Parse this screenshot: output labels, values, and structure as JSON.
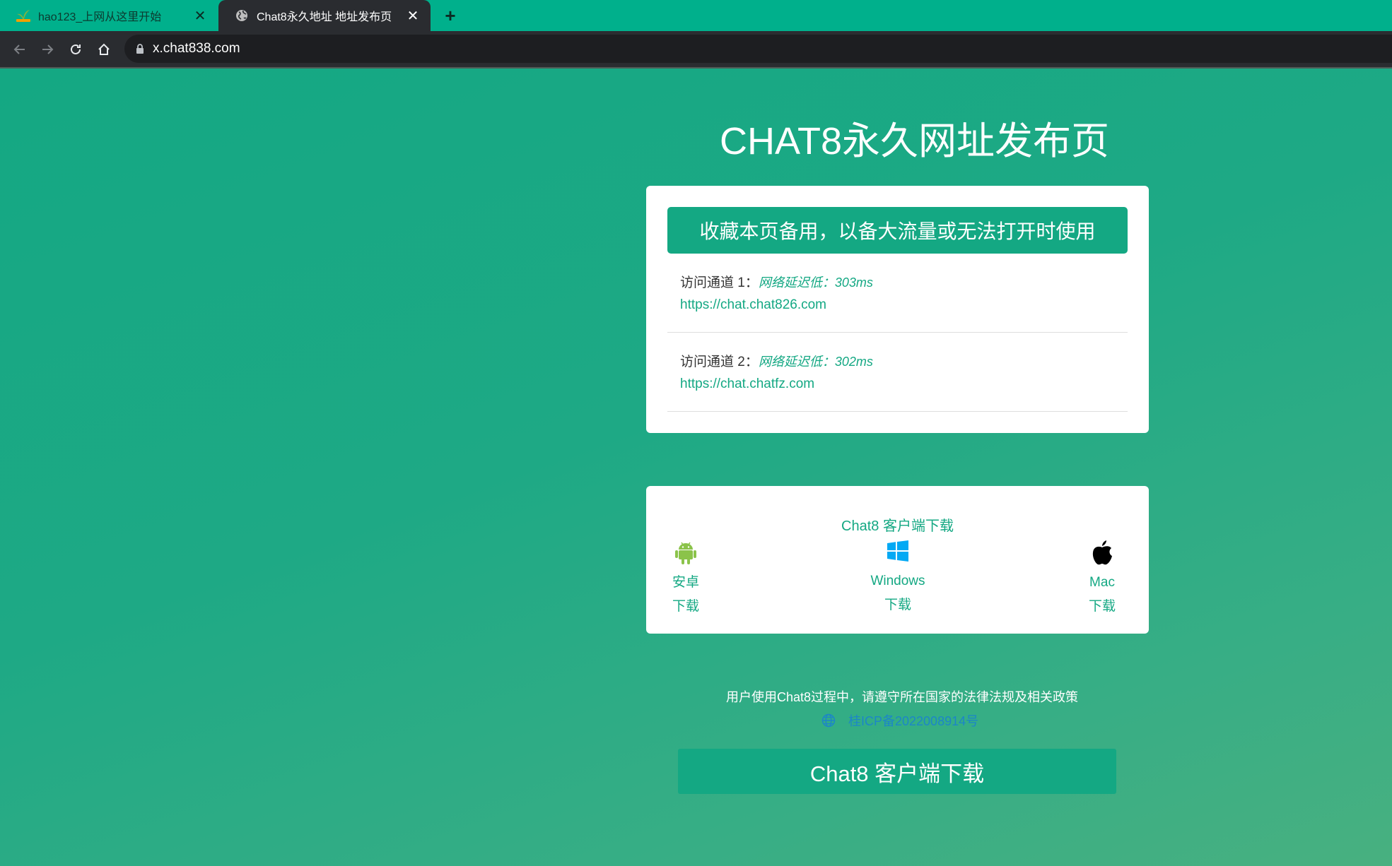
{
  "browser": {
    "tabs": [
      {
        "title": "hao123_上网从这里开始",
        "active": false,
        "icon": "hao123-favicon"
      },
      {
        "title": "Chat8永久地址 地址发布页",
        "active": true,
        "icon": "globe-favicon"
      }
    ],
    "url": "x.chat838.com"
  },
  "page": {
    "title": "CHAT8永久网址发布页",
    "banner": "收藏本页备用，以备大流量或无法打开时使用",
    "channels": [
      {
        "label": "访问通道 1：",
        "latency": "网络延迟低：303ms",
        "link": "https://chat.chat826.com"
      },
      {
        "label": "访问通道 2：",
        "latency": "网络延迟低：302ms",
        "link": "https://chat.chatfz.com"
      }
    ],
    "download": {
      "title": "Chat8 客户端下载",
      "items": [
        {
          "name": "安卓",
          "action": "下载",
          "icon": "android-icon"
        },
        {
          "name": "Windows",
          "action": "下载",
          "icon": "windows-icon"
        },
        {
          "name": "Mac",
          "action": "下载",
          "icon": "apple-icon"
        }
      ]
    },
    "notice": "用户使用Chat8过程中，请遵守所在国家的法律法规及相关政策",
    "icp": "桂ICP备2022008914号",
    "bottom_button": "Chat8 客户端下载"
  },
  "colors": {
    "accent": "#14a883",
    "tabstrip": "#00b08c",
    "toolbar": "#2a2c30",
    "icp_link": "#1c86c8"
  }
}
